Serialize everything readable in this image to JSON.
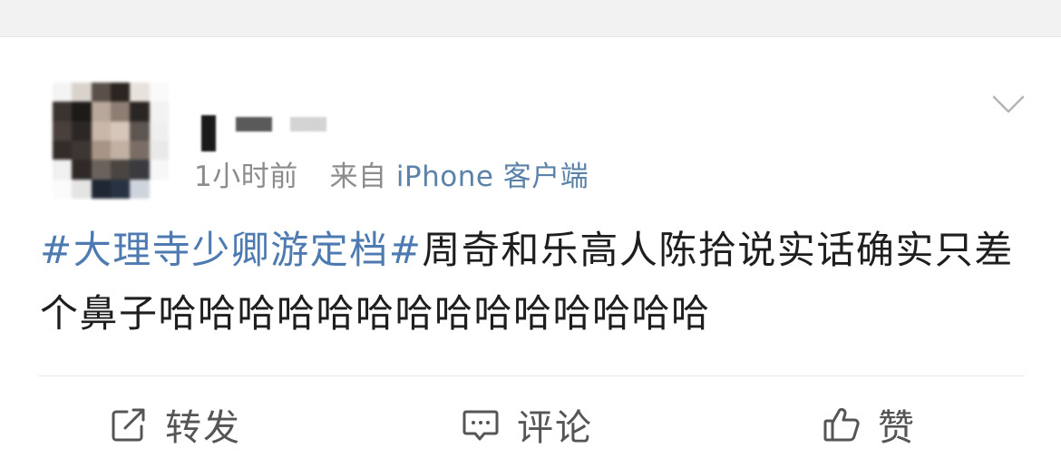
{
  "post": {
    "time": "1小时前",
    "source_prefix": "来自",
    "source_client": "iPhone 客户端",
    "topic": "#大理寺少卿游定档#",
    "body": "周奇和乐高人陈拾说实话确实只差个鼻子哈哈哈哈哈哈哈哈哈哈哈哈哈哈"
  },
  "actions": {
    "repost": {
      "label": "转发",
      "icon": "share-edit-icon"
    },
    "comment": {
      "label": "评论",
      "icon": "comment-bubble-icon"
    },
    "like": {
      "label": "赞",
      "icon": "thumbs-up-icon"
    }
  },
  "menu": {
    "icon": "chevron-down-icon"
  },
  "colors": {
    "topic": "#4d7ab1",
    "client": "#5b82a8",
    "meta": "#8c8c8c",
    "top_band": "#f2f2f2"
  }
}
